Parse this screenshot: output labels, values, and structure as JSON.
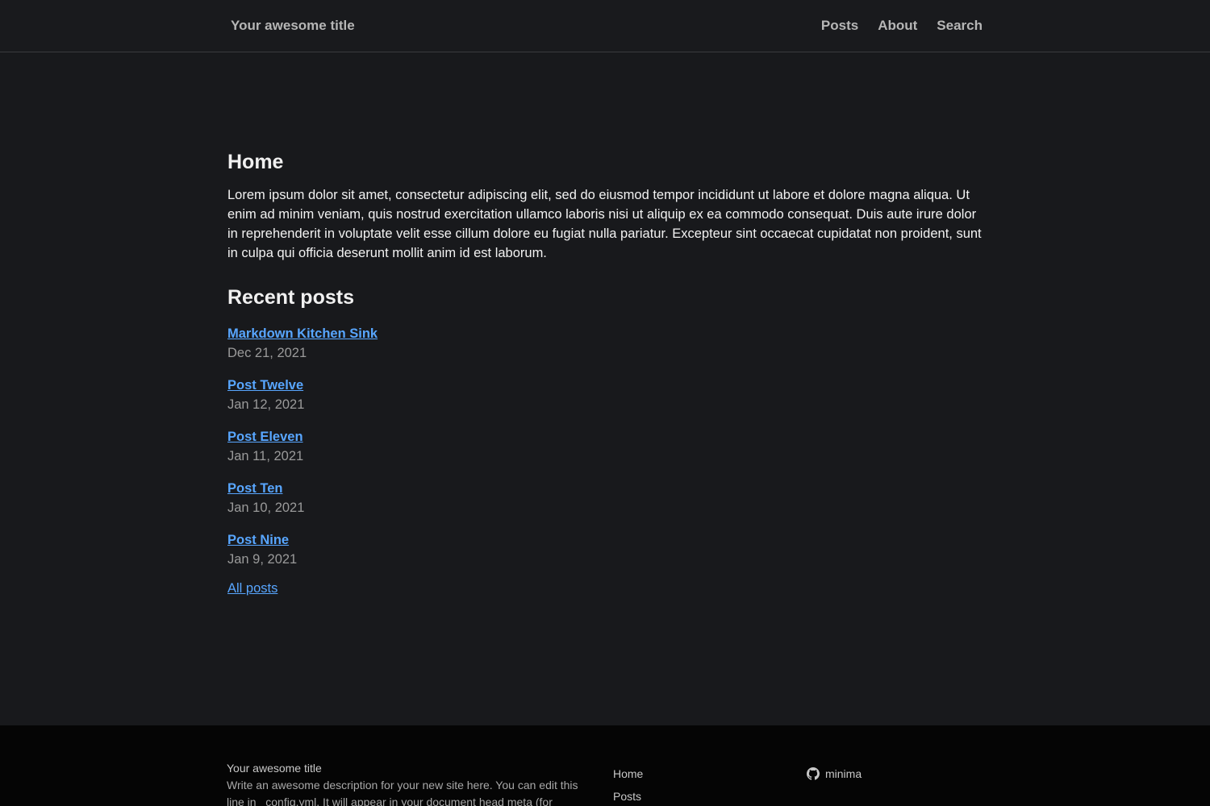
{
  "header": {
    "site_title": "Your awesome title",
    "nav": [
      {
        "label": "Posts"
      },
      {
        "label": "About"
      },
      {
        "label": "Search"
      }
    ]
  },
  "main": {
    "page_title": "Home",
    "intro": "Lorem ipsum dolor sit amet, consectetur adipiscing elit, sed do eiusmod tempor incididunt ut labore et dolore magna aliqua. Ut enim ad minim veniam, quis nostrud exercitation ullamco laboris nisi ut aliquip ex ea commodo consequat. Duis aute irure dolor in reprehenderit in voluptate velit esse cillum dolore eu fugiat nulla pariatur. Excepteur sint occaecat cupidatat non proident, sunt in culpa qui officia deserunt mollit anim id est laborum.",
    "recent_heading": "Recent posts",
    "posts": [
      {
        "title": "Markdown Kitchen Sink",
        "date": "Dec 21, 2021"
      },
      {
        "title": "Post Twelve",
        "date": "Jan 12, 2021"
      },
      {
        "title": "Post Eleven",
        "date": "Jan 11, 2021"
      },
      {
        "title": "Post Ten",
        "date": "Jan 10, 2021"
      },
      {
        "title": "Post Nine",
        "date": "Jan 9, 2021"
      }
    ],
    "all_posts_label": "All posts"
  },
  "footer": {
    "title": "Your awesome title",
    "description": "Write an awesome description for your new site here. You can edit this line in _config.yml. It will appear in your document head meta (for",
    "links": [
      {
        "label": "Home"
      },
      {
        "label": "Posts"
      }
    ],
    "social": {
      "icon": "github-icon",
      "label": "minima"
    }
  },
  "colors": {
    "background": "#18191c",
    "link": "#58a6ff",
    "footer_background": "#050505"
  }
}
